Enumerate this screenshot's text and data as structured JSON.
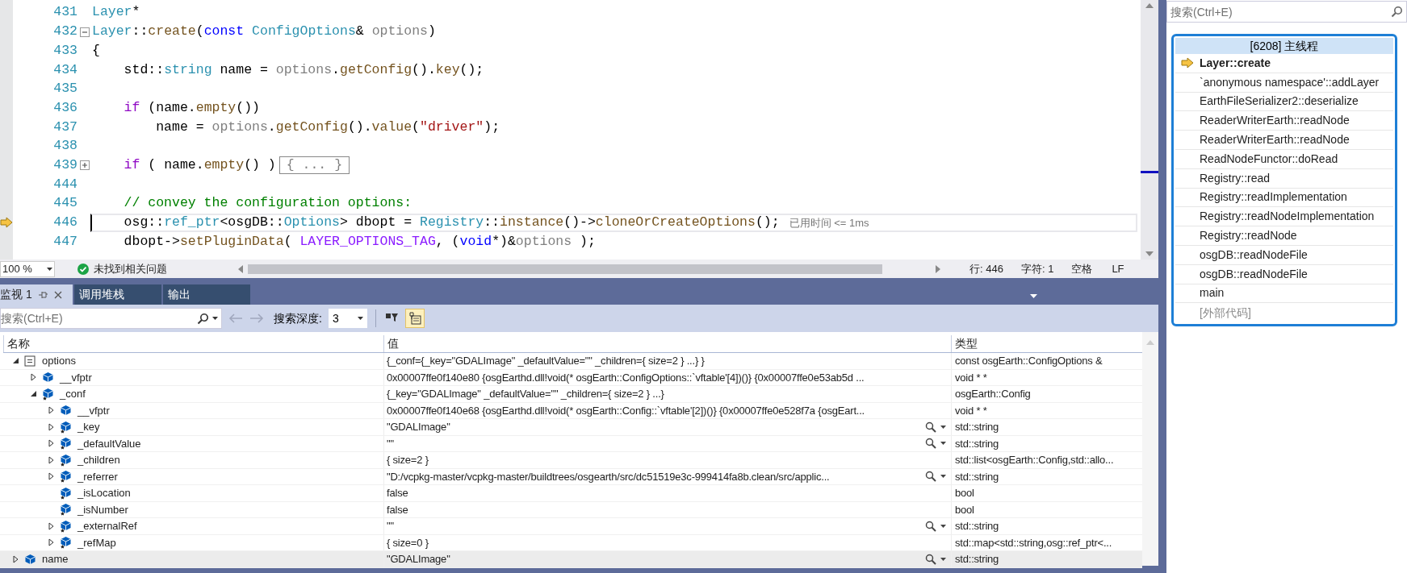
{
  "editor": {
    "lines": [
      {
        "number": "431",
        "current": false,
        "tokens": [
          {
            "kind": "type",
            "text": "Layer"
          },
          {
            "kind": "plain",
            "text": "*"
          }
        ]
      },
      {
        "number": "432",
        "current": false,
        "folded": false,
        "tokens": [
          {
            "kind": "type",
            "text": "Layer"
          },
          {
            "kind": "plain",
            "text": "::"
          },
          {
            "kind": "func",
            "text": "create"
          },
          {
            "kind": "plain",
            "text": "("
          },
          {
            "kind": "keyword",
            "text": "const "
          },
          {
            "kind": "type",
            "text": "ConfigOptions"
          },
          {
            "kind": "plain",
            "text": "& "
          },
          {
            "kind": "param",
            "text": "options"
          },
          {
            "kind": "plain",
            "text": ")"
          }
        ]
      },
      {
        "number": "433",
        "current": false,
        "tokens": [
          {
            "kind": "plain",
            "text": "{"
          }
        ]
      },
      {
        "number": "434",
        "current": false,
        "tokens": [
          {
            "kind": "plain",
            "text": "    std::"
          },
          {
            "kind": "type",
            "text": "string"
          },
          {
            "kind": "plain",
            "text": " name = "
          },
          {
            "kind": "param",
            "text": "options"
          },
          {
            "kind": "plain",
            "text": "."
          },
          {
            "kind": "func",
            "text": "getConfig"
          },
          {
            "kind": "plain",
            "text": "()."
          },
          {
            "kind": "func",
            "text": "key"
          },
          {
            "kind": "plain",
            "text": "();"
          }
        ]
      },
      {
        "number": "435",
        "current": false
      },
      {
        "number": "436",
        "current": false,
        "tokens": [
          {
            "kind": "control",
            "text": "    if"
          },
          {
            "kind": "plain",
            "text": " (name."
          },
          {
            "kind": "func",
            "text": "empty"
          },
          {
            "kind": "plain",
            "text": "())"
          }
        ]
      },
      {
        "number": "437",
        "current": false,
        "tokens": [
          {
            "kind": "plain",
            "text": "        name = "
          },
          {
            "kind": "param",
            "text": "options"
          },
          {
            "kind": "plain",
            "text": "."
          },
          {
            "kind": "func",
            "text": "getConfig"
          },
          {
            "kind": "plain",
            "text": "()."
          },
          {
            "kind": "func",
            "text": "value"
          },
          {
            "kind": "plain",
            "text": "("
          },
          {
            "kind": "string",
            "text": "\"driver\""
          },
          {
            "kind": "plain",
            "text": ");"
          }
        ]
      },
      {
        "number": "438",
        "current": false
      },
      {
        "number": "439",
        "current": false,
        "folded": true,
        "folded_text": "{ ... }",
        "tokens": [
          {
            "kind": "control",
            "text": "    if"
          },
          {
            "kind": "plain",
            "text": " ( name."
          },
          {
            "kind": "func",
            "text": "empty"
          },
          {
            "kind": "plain",
            "text": "() )"
          }
        ]
      },
      {
        "number": "444",
        "current": false
      },
      {
        "number": "445",
        "current": false,
        "tokens": [
          {
            "kind": "comment",
            "text": "    // convey the configuration options:"
          }
        ]
      },
      {
        "number": "446",
        "current": true,
        "hint": "已用时间 <= 1ms",
        "tokens": [
          {
            "kind": "plain",
            "text": "    osg::"
          },
          {
            "kind": "type",
            "text": "ref_ptr"
          },
          {
            "kind": "plain",
            "text": "<osgDB::"
          },
          {
            "kind": "type",
            "text": "Options"
          },
          {
            "kind": "plain",
            "text": "> dbopt = "
          },
          {
            "kind": "type",
            "text": "Registry"
          },
          {
            "kind": "plain",
            "text": "::"
          },
          {
            "kind": "func",
            "text": "instance"
          },
          {
            "kind": "plain",
            "text": "()->"
          },
          {
            "kind": "func",
            "text": "cloneOrCreateOptions"
          },
          {
            "kind": "plain",
            "text": "();"
          }
        ]
      },
      {
        "number": "447",
        "current": false,
        "tokens": [
          {
            "kind": "plain",
            "text": "    dbopt->"
          },
          {
            "kind": "func",
            "text": "setPluginData"
          },
          {
            "kind": "plain",
            "text": "( "
          },
          {
            "kind": "macro",
            "text": "LAYER_OPTIONS_TAG"
          },
          {
            "kind": "plain",
            "text": ", ("
          },
          {
            "kind": "keyword",
            "text": "void"
          },
          {
            "kind": "plain",
            "text": "*)&"
          },
          {
            "kind": "param",
            "text": "options"
          },
          {
            "kind": "plain",
            "text": " );"
          }
        ]
      }
    ]
  },
  "status": {
    "zoom": "100 %",
    "issues": "未找到相关问题",
    "line": "行: 446",
    "column": "字符: 1",
    "indent": "空格",
    "eol": "LF"
  },
  "watch": {
    "tabs": [
      {
        "label": "监视 1",
        "selected": true
      },
      {
        "label": "调用堆栈",
        "selected": false
      },
      {
        "label": "输出",
        "selected": false
      }
    ],
    "search": {
      "placeholder": "搜索(Ctrl+E)"
    },
    "depth_label": "搜索深度:",
    "depth": "3",
    "toggle_on": true,
    "columns": [
      "名称",
      "值",
      "类型"
    ],
    "rows": [
      {
        "name": "options",
        "kind": "param",
        "expanded": true,
        "value": "{_conf={_key=\"GDALImage\" _defaultValue=\"\" _children={ size=2 } ...} }",
        "type": "const osgEarth::ConfigOptions &",
        "visualizer": false,
        "selected": false,
        "children": [
          {
            "name": "__vfptr",
            "kind": "field",
            "expanded": false,
            "value": "0x00007ffe0f140e80 {osgEarthd.dll!void(* osgEarth::ConfigOptions::`vftable'[4])()} {0x00007ffe0e53ab5d ...",
            "type": "void * *",
            "visualizer": false,
            "selected": false
          },
          {
            "name": "_conf",
            "kind": "protected",
            "expanded": true,
            "value": "{_key=\"GDALImage\" _defaultValue=\"\" _children={ size=2 } ...}",
            "type": "osgEarth::Config",
            "visualizer": false,
            "selected": false,
            "children": [
              {
                "name": "__vfptr",
                "kind": "field",
                "expanded": false,
                "value": "0x00007ffe0f140e68 {osgEarthd.dll!void(* osgEarth::Config::`vftable'[2])()} {0x00007ffe0e528f7a {osgEart...",
                "type": "void * *",
                "visualizer": false,
                "selected": false
              },
              {
                "name": "_key",
                "kind": "protected",
                "expanded": false,
                "value": "\"GDALImage\"",
                "type": "std::string",
                "visualizer": true,
                "selected": false
              },
              {
                "name": "_defaultValue",
                "kind": "protected",
                "expanded": false,
                "value": "\"\"",
                "type": "std::string",
                "visualizer": true,
                "selected": false
              },
              {
                "name": "_children",
                "kind": "protected",
                "expanded": false,
                "value": "{ size=2 }",
                "type": "std::list<osgEarth::Config,std::allo...",
                "visualizer": false,
                "selected": false
              },
              {
                "name": "_referrer",
                "kind": "protected",
                "expanded": false,
                "value": "\"D:/vcpkg-master/vcpkg-master/buildtrees/osgearth/src/dc51519e3c-999414fa8b.clean/src/applic...",
                "type": "std::string",
                "visualizer": true,
                "selected": false
              },
              {
                "name": "_isLocation",
                "kind": "protected",
                "value": "false",
                "type": "bool",
                "visualizer": false,
                "selected": false
              },
              {
                "name": "_isNumber",
                "kind": "protected",
                "value": "false",
                "type": "bool",
                "visualizer": false,
                "selected": false
              },
              {
                "name": "_externalRef",
                "kind": "protected",
                "expanded": false,
                "value": "\"\"",
                "type": "std::string",
                "visualizer": true,
                "selected": false
              },
              {
                "name": "_refMap",
                "kind": "protected",
                "expanded": false,
                "value": "{ size=0 }",
                "type": "std::map<std::string,osg::ref_ptr<...",
                "visualizer": false,
                "selected": false
              }
            ]
          }
        ]
      },
      {
        "name": "name",
        "kind": "field",
        "expanded": false,
        "value": "\"GDALImage\"",
        "type": "std::string",
        "visualizer": true,
        "selected": true
      }
    ]
  },
  "call_stack": {
    "search": {
      "placeholder": "搜索(Ctrl+E)"
    },
    "thread": "[6208] 主线程",
    "frames": [
      {
        "name": "Layer::create",
        "kind": "code",
        "current": true
      },
      {
        "name": "`anonymous namespace'::addLayer",
        "kind": "code",
        "current": false
      },
      {
        "name": "EarthFileSerializer2::deserialize",
        "kind": "code",
        "current": false
      },
      {
        "name": "ReaderWriterEarth::readNode",
        "kind": "code",
        "current": false
      },
      {
        "name": "ReaderWriterEarth::readNode",
        "kind": "code",
        "current": false
      },
      {
        "name": "ReadNodeFunctor::doRead",
        "kind": "code",
        "current": false
      },
      {
        "name": "Registry::read",
        "kind": "code",
        "current": false
      },
      {
        "name": "Registry::readImplementation",
        "kind": "code",
        "current": false
      },
      {
        "name": "Registry::readNodeImplementation",
        "kind": "code",
        "current": false
      },
      {
        "name": "Registry::readNode",
        "kind": "code",
        "current": false
      },
      {
        "name": "osgDB::readNodeFile",
        "kind": "code",
        "current": false
      },
      {
        "name": "osgDB::readNodeFile",
        "kind": "code",
        "current": false
      },
      {
        "name": "main",
        "kind": "code",
        "current": false
      },
      {
        "name": "[外部代码]",
        "kind": "external",
        "current": false
      }
    ]
  }
}
